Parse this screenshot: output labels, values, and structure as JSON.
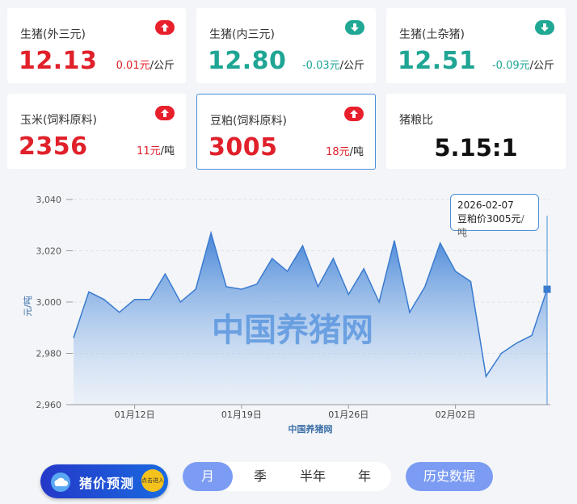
{
  "cards": [
    {
      "name": "生猪(外三元)",
      "value": "12.13",
      "change": "0.01元",
      "unit": "/公斤",
      "direction": "up"
    },
    {
      "name": "生猪(内三元)",
      "value": "12.80",
      "change": "-0.03元",
      "unit": "/公斤",
      "direction": "down"
    },
    {
      "name": "生猪(土杂猪)",
      "value": "12.51",
      "change": "-0.09元",
      "unit": "/公斤",
      "direction": "down"
    },
    {
      "name": "玉米(饲料原料)",
      "value": "2356",
      "change": "11元",
      "unit": "/吨",
      "direction": "up"
    },
    {
      "name": "豆粕(饲料原料)",
      "value": "3005",
      "change": "18元",
      "unit": "/吨",
      "direction": "up"
    }
  ],
  "ratio": {
    "name": "猪粮比",
    "value": "5.15:1"
  },
  "colors": {
    "up": "#e0202a",
    "down": "#1fa594",
    "accent": "#4a8fd8",
    "button": "#7b9cf2"
  },
  "chart_data": {
    "type": "area",
    "xlabel": "中国养猪网",
    "ylabel": "元/吨",
    "ylim": [
      2960,
      3040
    ],
    "yticks": [
      2960,
      2980,
      3000,
      3020,
      3040
    ],
    "ytick_labels": [
      "2,960",
      "2,980",
      "3,000",
      "3,020",
      "3,040"
    ],
    "xtick_labels": [
      "01月12日",
      "01月19日",
      "01月26日",
      "02月02日"
    ],
    "xtick_index": [
      4,
      11,
      18,
      25
    ],
    "watermark": "中国养猪网",
    "grid": true,
    "x": [
      "01-08",
      "01-09",
      "01-10",
      "01-11",
      "01-12",
      "01-13",
      "01-14",
      "01-15",
      "01-16",
      "01-17",
      "01-18",
      "01-19",
      "01-20",
      "01-21",
      "01-22",
      "01-23",
      "01-24",
      "01-25",
      "01-26",
      "01-27",
      "01-28",
      "01-29",
      "01-30",
      "01-31",
      "02-01",
      "02-02",
      "02-03",
      "02-04",
      "02-05",
      "02-06",
      "02-07"
    ],
    "values": [
      2986,
      3004,
      3001,
      2996,
      3001,
      3001,
      3011,
      3000,
      3005,
      3027,
      3006,
      3005,
      3007,
      3017,
      3012,
      3022,
      3006,
      3017,
      3003,
      3013,
      3000,
      3024,
      2996,
      3006,
      3023,
      3012,
      3008,
      2971,
      2980,
      2984,
      2987,
      3005
    ],
    "tooltip": {
      "date": "2026-02-07",
      "label": "豆粕价",
      "value": "3005元",
      "unit": "/吨"
    }
  },
  "footer": {
    "predict_label": "猪价预测",
    "predict_badge": "点击进入",
    "tabs": [
      "月",
      "季",
      "半年",
      "年"
    ],
    "active_tab": "月",
    "history_label": "历史数据"
  }
}
